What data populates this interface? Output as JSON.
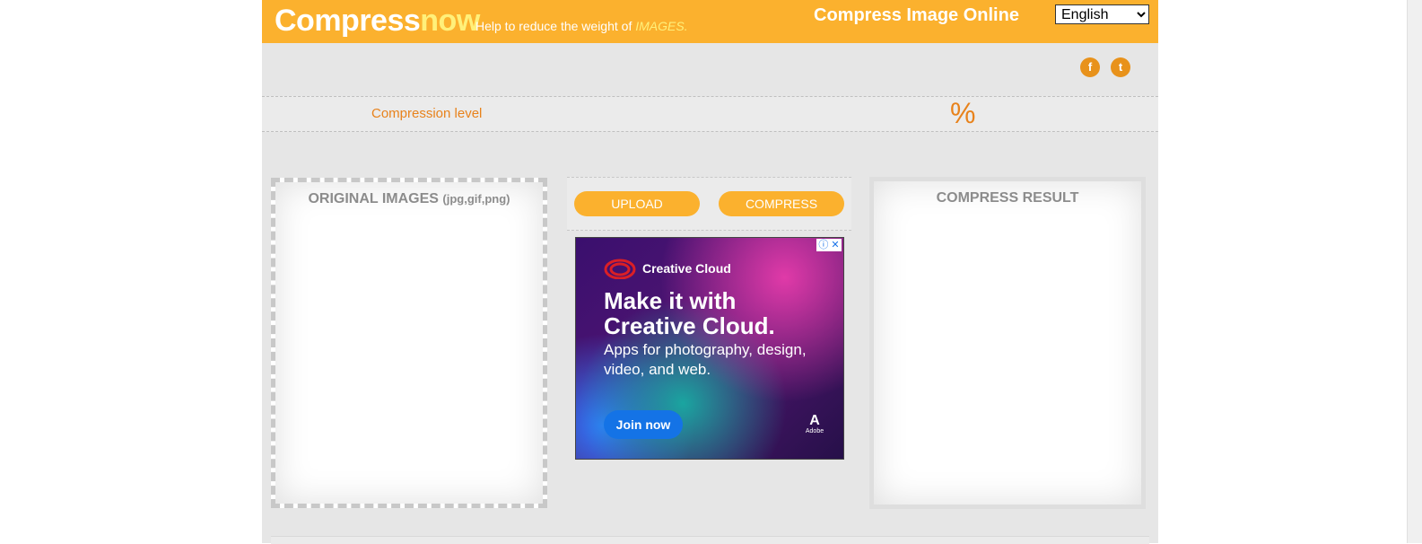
{
  "header": {
    "logo_main": "Compress",
    "logo_accent": "now",
    "tagline_prefix": "Help to reduce the weight of ",
    "tagline_accent": "IMAGES.",
    "site_title": "Compress Image Online",
    "language": {
      "selected": "English",
      "options": [
        "English"
      ]
    }
  },
  "social": {
    "facebook_glyph": "f",
    "twitter_glyph": "t"
  },
  "compression": {
    "label": "Compression level",
    "unit": "%"
  },
  "original_panel": {
    "title": "ORIGINAL IMAGES",
    "formats": "(jpg,gif,png)"
  },
  "actions": {
    "upload_label": "UPLOAD",
    "compress_label": "COMPRESS"
  },
  "result_panel": {
    "title": "COMPRESS RESULT"
  },
  "ad": {
    "brand": "Creative Cloud",
    "headline_line1": "Make it with",
    "headline_line2": "Creative Cloud.",
    "sub_line1": "Apps for photography, design,",
    "sub_line2": "video, and web.",
    "cta": "Join now",
    "adobe_word": "Adobe",
    "adobe_mark": "A",
    "choices_glyphs": "ⓘ ✕"
  },
  "colors": {
    "accent_orange": "#fbb12e",
    "label_orange": "#e8821b",
    "logo_yellow": "#fff07a"
  },
  "icons": [
    "facebook-icon",
    "twitter-icon",
    "creative-cloud-logo-icon",
    "adobe-logo-icon",
    "ad-info-icon",
    "ad-close-icon"
  ]
}
